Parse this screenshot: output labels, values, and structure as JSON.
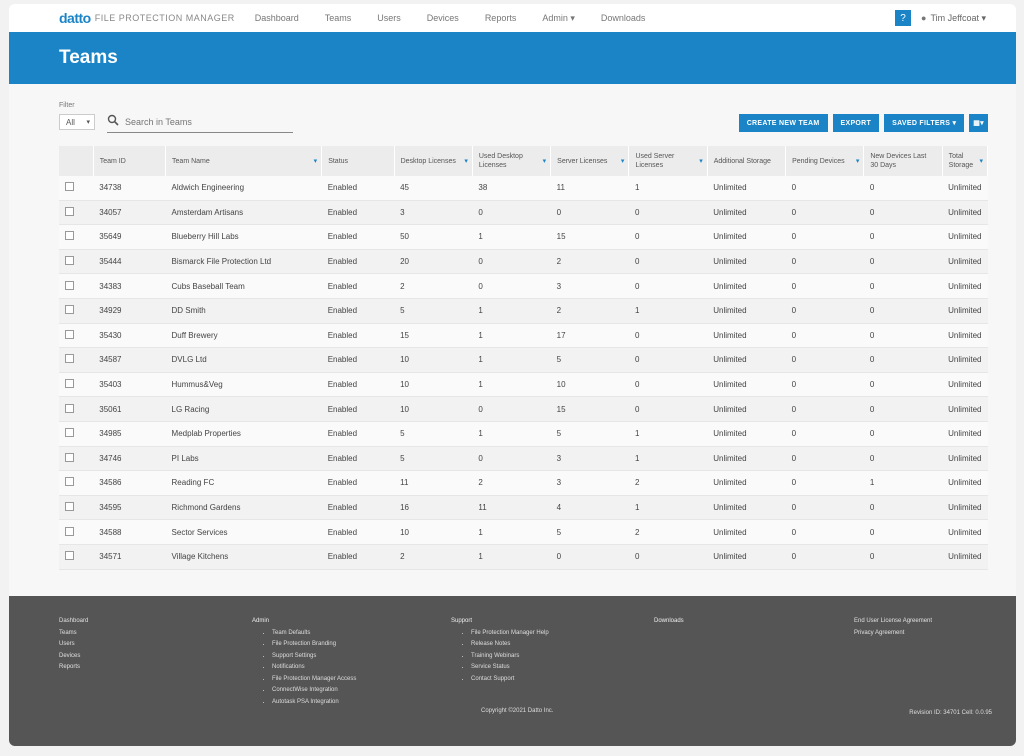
{
  "topnav": {
    "logo": "datto",
    "product": "FILE PROTECTION MANAGER",
    "items": [
      "Dashboard",
      "Teams",
      "Users",
      "Devices",
      "Reports",
      "Admin",
      "Downloads"
    ],
    "help": "?",
    "user": "Tim Jeffcoat"
  },
  "page_title": "Teams",
  "filter": {
    "label": "Filter",
    "select_value": "All",
    "search_placeholder": "Search in Teams"
  },
  "buttons": {
    "create": "CREATE NEW TEAM",
    "export": "EXPORT",
    "saved_filters": "SAVED FILTERS",
    "columns_icon": "columns-icon"
  },
  "table": {
    "headers": [
      "Team ID",
      "Team Name",
      "Status",
      "Desktop Licenses",
      "Used Desktop Licenses",
      "Server Licenses",
      "Used Server Licenses",
      "Additional Storage",
      "Pending Devices",
      "New Devices Last 30 Days",
      "Total Storage"
    ],
    "rows": [
      [
        "34738",
        "Aldwich Engineering",
        "Enabled",
        "45",
        "38",
        "11",
        "1",
        "Unlimited",
        "0",
        "0",
        "Unlimited"
      ],
      [
        "34057",
        "Amsterdam Artisans",
        "Enabled",
        "3",
        "0",
        "0",
        "0",
        "Unlimited",
        "0",
        "0",
        "Unlimited"
      ],
      [
        "35649",
        "Blueberry Hill Labs",
        "Enabled",
        "50",
        "1",
        "15",
        "0",
        "Unlimited",
        "0",
        "0",
        "Unlimited"
      ],
      [
        "35444",
        "Bismarck File Protection Ltd",
        "Enabled",
        "20",
        "0",
        "2",
        "0",
        "Unlimited",
        "0",
        "0",
        "Unlimited"
      ],
      [
        "34383",
        "Cubs Baseball Team",
        "Enabled",
        "2",
        "0",
        "3",
        "0",
        "Unlimited",
        "0",
        "0",
        "Unlimited"
      ],
      [
        "34929",
        "DD Smith",
        "Enabled",
        "5",
        "1",
        "2",
        "1",
        "Unlimited",
        "0",
        "0",
        "Unlimited"
      ],
      [
        "35430",
        "Duff Brewery",
        "Enabled",
        "15",
        "1",
        "17",
        "0",
        "Unlimited",
        "0",
        "0",
        "Unlimited"
      ],
      [
        "34587",
        "DVLG Ltd",
        "Enabled",
        "10",
        "1",
        "5",
        "0",
        "Unlimited",
        "0",
        "0",
        "Unlimited"
      ],
      [
        "35403",
        "Hummus&Veg",
        "Enabled",
        "10",
        "1",
        "10",
        "0",
        "Unlimited",
        "0",
        "0",
        "Unlimited"
      ],
      [
        "35061",
        "LG Racing",
        "Enabled",
        "10",
        "0",
        "15",
        "0",
        "Unlimited",
        "0",
        "0",
        "Unlimited"
      ],
      [
        "34985",
        "Medplab Properties",
        "Enabled",
        "5",
        "1",
        "5",
        "1",
        "Unlimited",
        "0",
        "0",
        "Unlimited"
      ],
      [
        "34746",
        "PI Labs",
        "Enabled",
        "5",
        "0",
        "3",
        "1",
        "Unlimited",
        "0",
        "0",
        "Unlimited"
      ],
      [
        "34586",
        "Reading FC",
        "Enabled",
        "11",
        "2",
        "3",
        "2",
        "Unlimited",
        "0",
        "1",
        "Unlimited"
      ],
      [
        "34595",
        "Richmond Gardens",
        "Enabled",
        "16",
        "11",
        "4",
        "1",
        "Unlimited",
        "0",
        "0",
        "Unlimited"
      ],
      [
        "34588",
        "Sector Services",
        "Enabled",
        "10",
        "1",
        "5",
        "2",
        "Unlimited",
        "0",
        "0",
        "Unlimited"
      ],
      [
        "34571",
        "Village Kitchens",
        "Enabled",
        "2",
        "1",
        "0",
        "0",
        "Unlimited",
        "0",
        "0",
        "Unlimited"
      ]
    ]
  },
  "footer": {
    "col1": [
      "Dashboard",
      "Teams",
      "Users",
      "Devices",
      "Reports"
    ],
    "admin_title": "Admin",
    "admin_items": [
      "Team Defaults",
      "File Protection Branding",
      "Support Settings",
      "Notifications",
      "File Protection Manager Access",
      "ConnectWise Integration",
      "Autotask PSA Integration"
    ],
    "support_title": "Support",
    "support_items": [
      "File Protection Manager Help",
      "Release Notes",
      "Training Webinars",
      "Service Status",
      "Contact Support"
    ],
    "downloads": "Downloads",
    "legal": [
      "End User License Agreement",
      "Privacy Agreement"
    ],
    "copyright": "Copyright ©2021 Datto Inc.",
    "version": "Revision ID: 34701    Cell: 0.0.95"
  }
}
